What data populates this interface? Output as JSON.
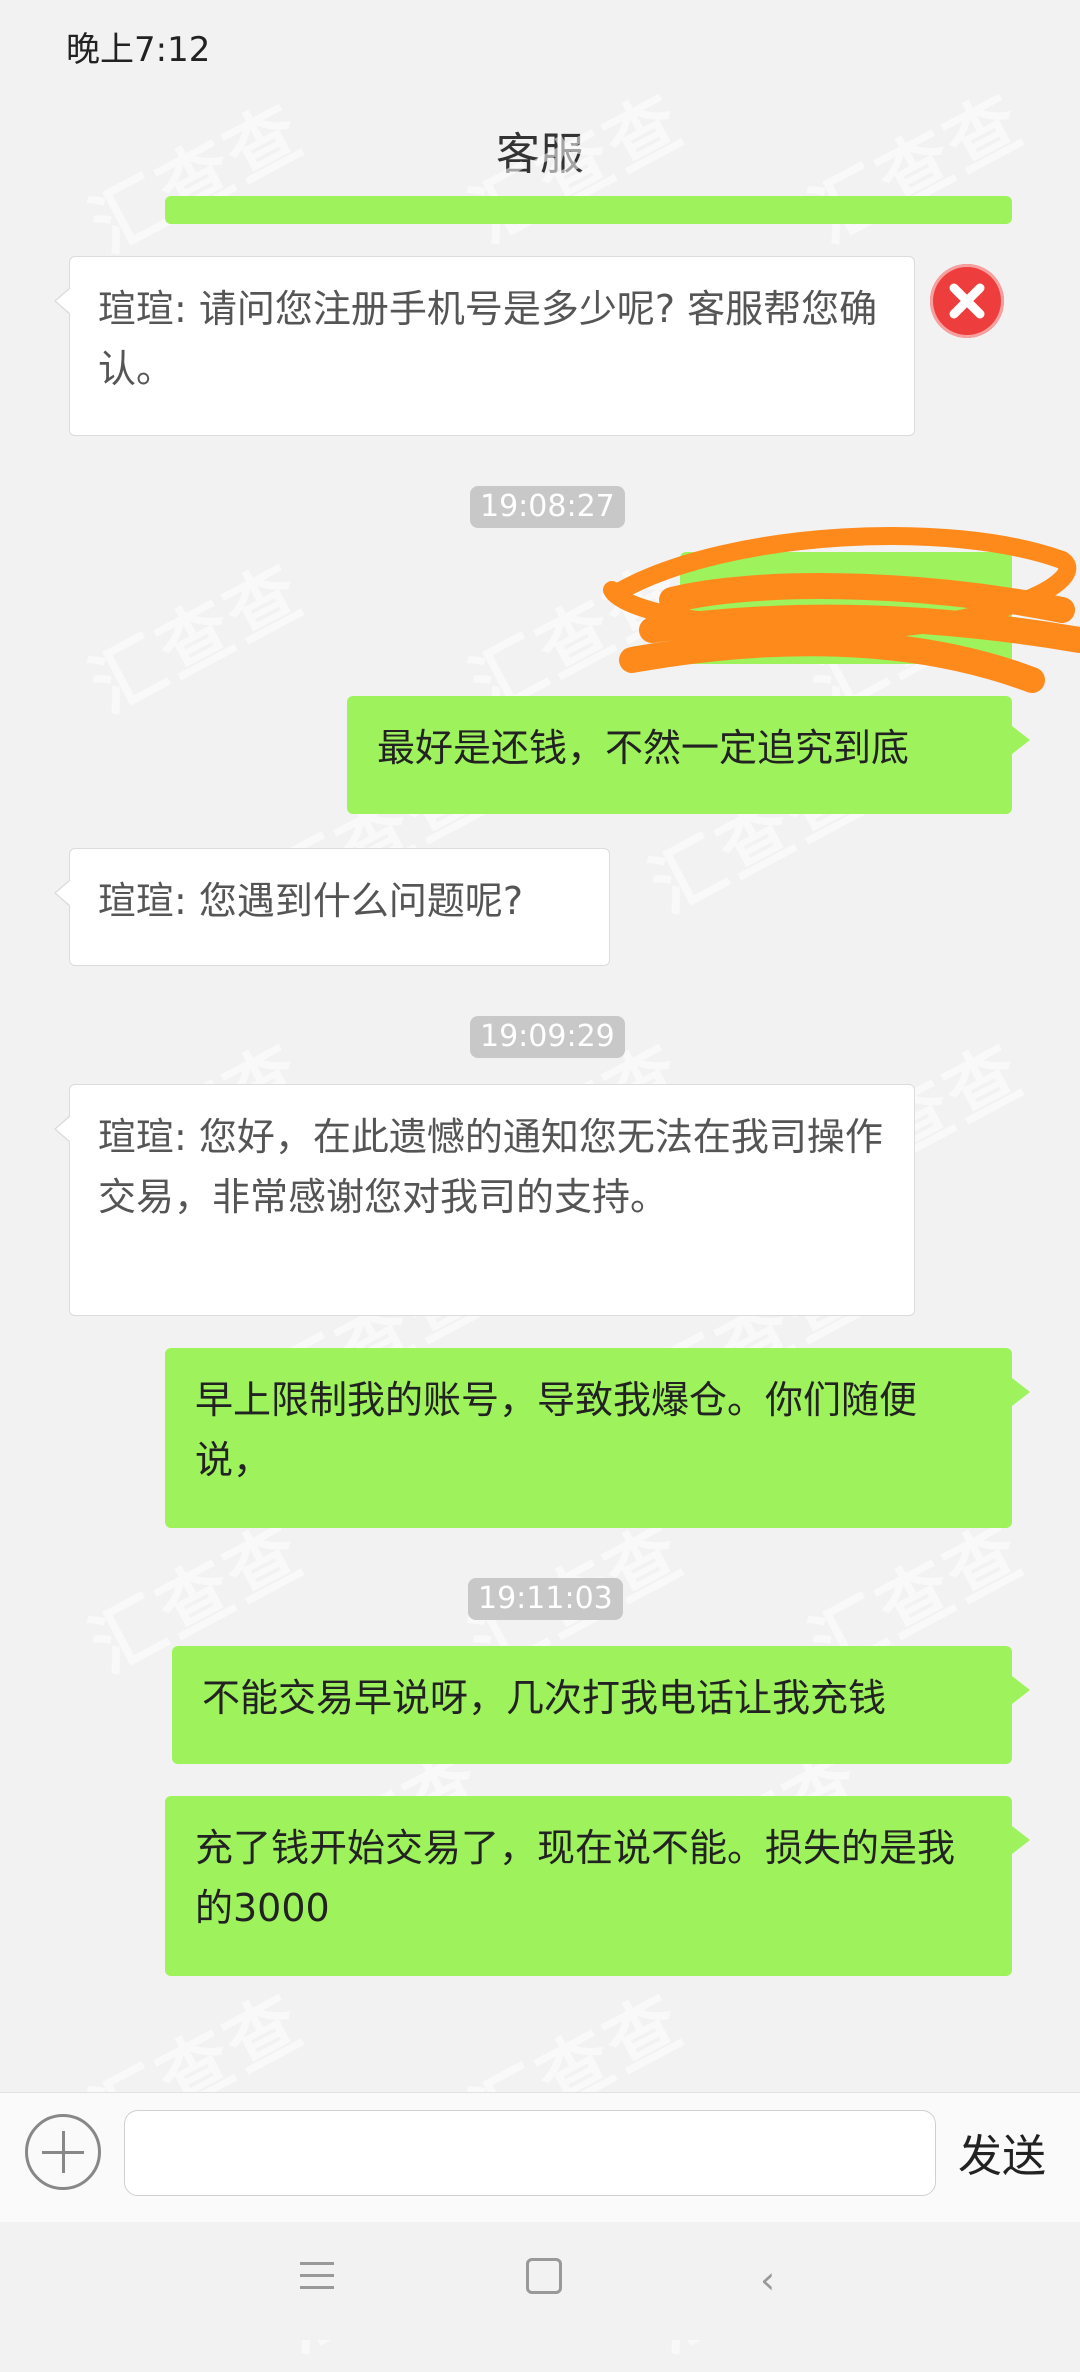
{
  "status_bar": {
    "time": "晚上7:12"
  },
  "header": {
    "title": "客服"
  },
  "messages": {
    "m1": "瑄瑄: 请问您注册手机号是多少呢? 客服帮您确认。",
    "ts1": "19:08:27",
    "m2": "最好是还钱，不然一定追究到底",
    "m3": "瑄瑄: 您遇到什么问题呢?",
    "ts2": "19:09:29",
    "m4": "瑄瑄: 您好，在此遗憾的通知您无法在我司操作交易，非常感谢您对我司的支持。",
    "m5": "早上限制我的账号，导致我爆仓。你们随便说，",
    "ts3": "19:11:03",
    "m6": "不能交易早说呀，几次打我电话让我充钱",
    "m7": "充了钱开始交易了，现在说不能。损失的是我的3000"
  },
  "watermark": {
    "text": "汇查查"
  },
  "input_bar": {
    "value": "",
    "send_label": "发送"
  },
  "colors": {
    "sent_bubble": "#9ef25c",
    "error": "#ee3d3d",
    "scribble": "#ff8a1c"
  }
}
